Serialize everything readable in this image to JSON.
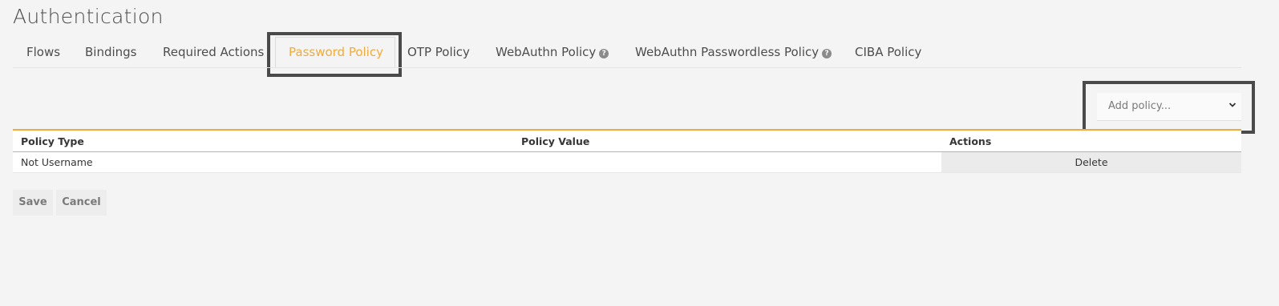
{
  "page": {
    "title": "Authentication"
  },
  "tabs": [
    {
      "label": "Flows"
    },
    {
      "label": "Bindings"
    },
    {
      "label": "Required Actions"
    },
    {
      "label": "Password Policy",
      "active": true
    },
    {
      "label": "OTP Policy"
    },
    {
      "label": "WebAuthn Policy",
      "help_icon": "question-circle-icon"
    },
    {
      "label": "WebAuthn Passwordless Policy",
      "help_icon": "question-circle-icon"
    },
    {
      "label": "CIBA Policy"
    }
  ],
  "policy_select": {
    "selected": "Add policy..."
  },
  "table": {
    "columns": [
      "Policy Type",
      "Policy Value",
      "Actions"
    ],
    "rows": [
      {
        "policy_type": "Not Username",
        "policy_value": "",
        "action": "Delete"
      }
    ]
  },
  "buttons": {
    "save": "Save",
    "cancel": "Cancel"
  },
  "colors": {
    "accent": "#f0ab3c",
    "background": "#f4f4f4",
    "highlight_frame": "#4a4a4a"
  }
}
